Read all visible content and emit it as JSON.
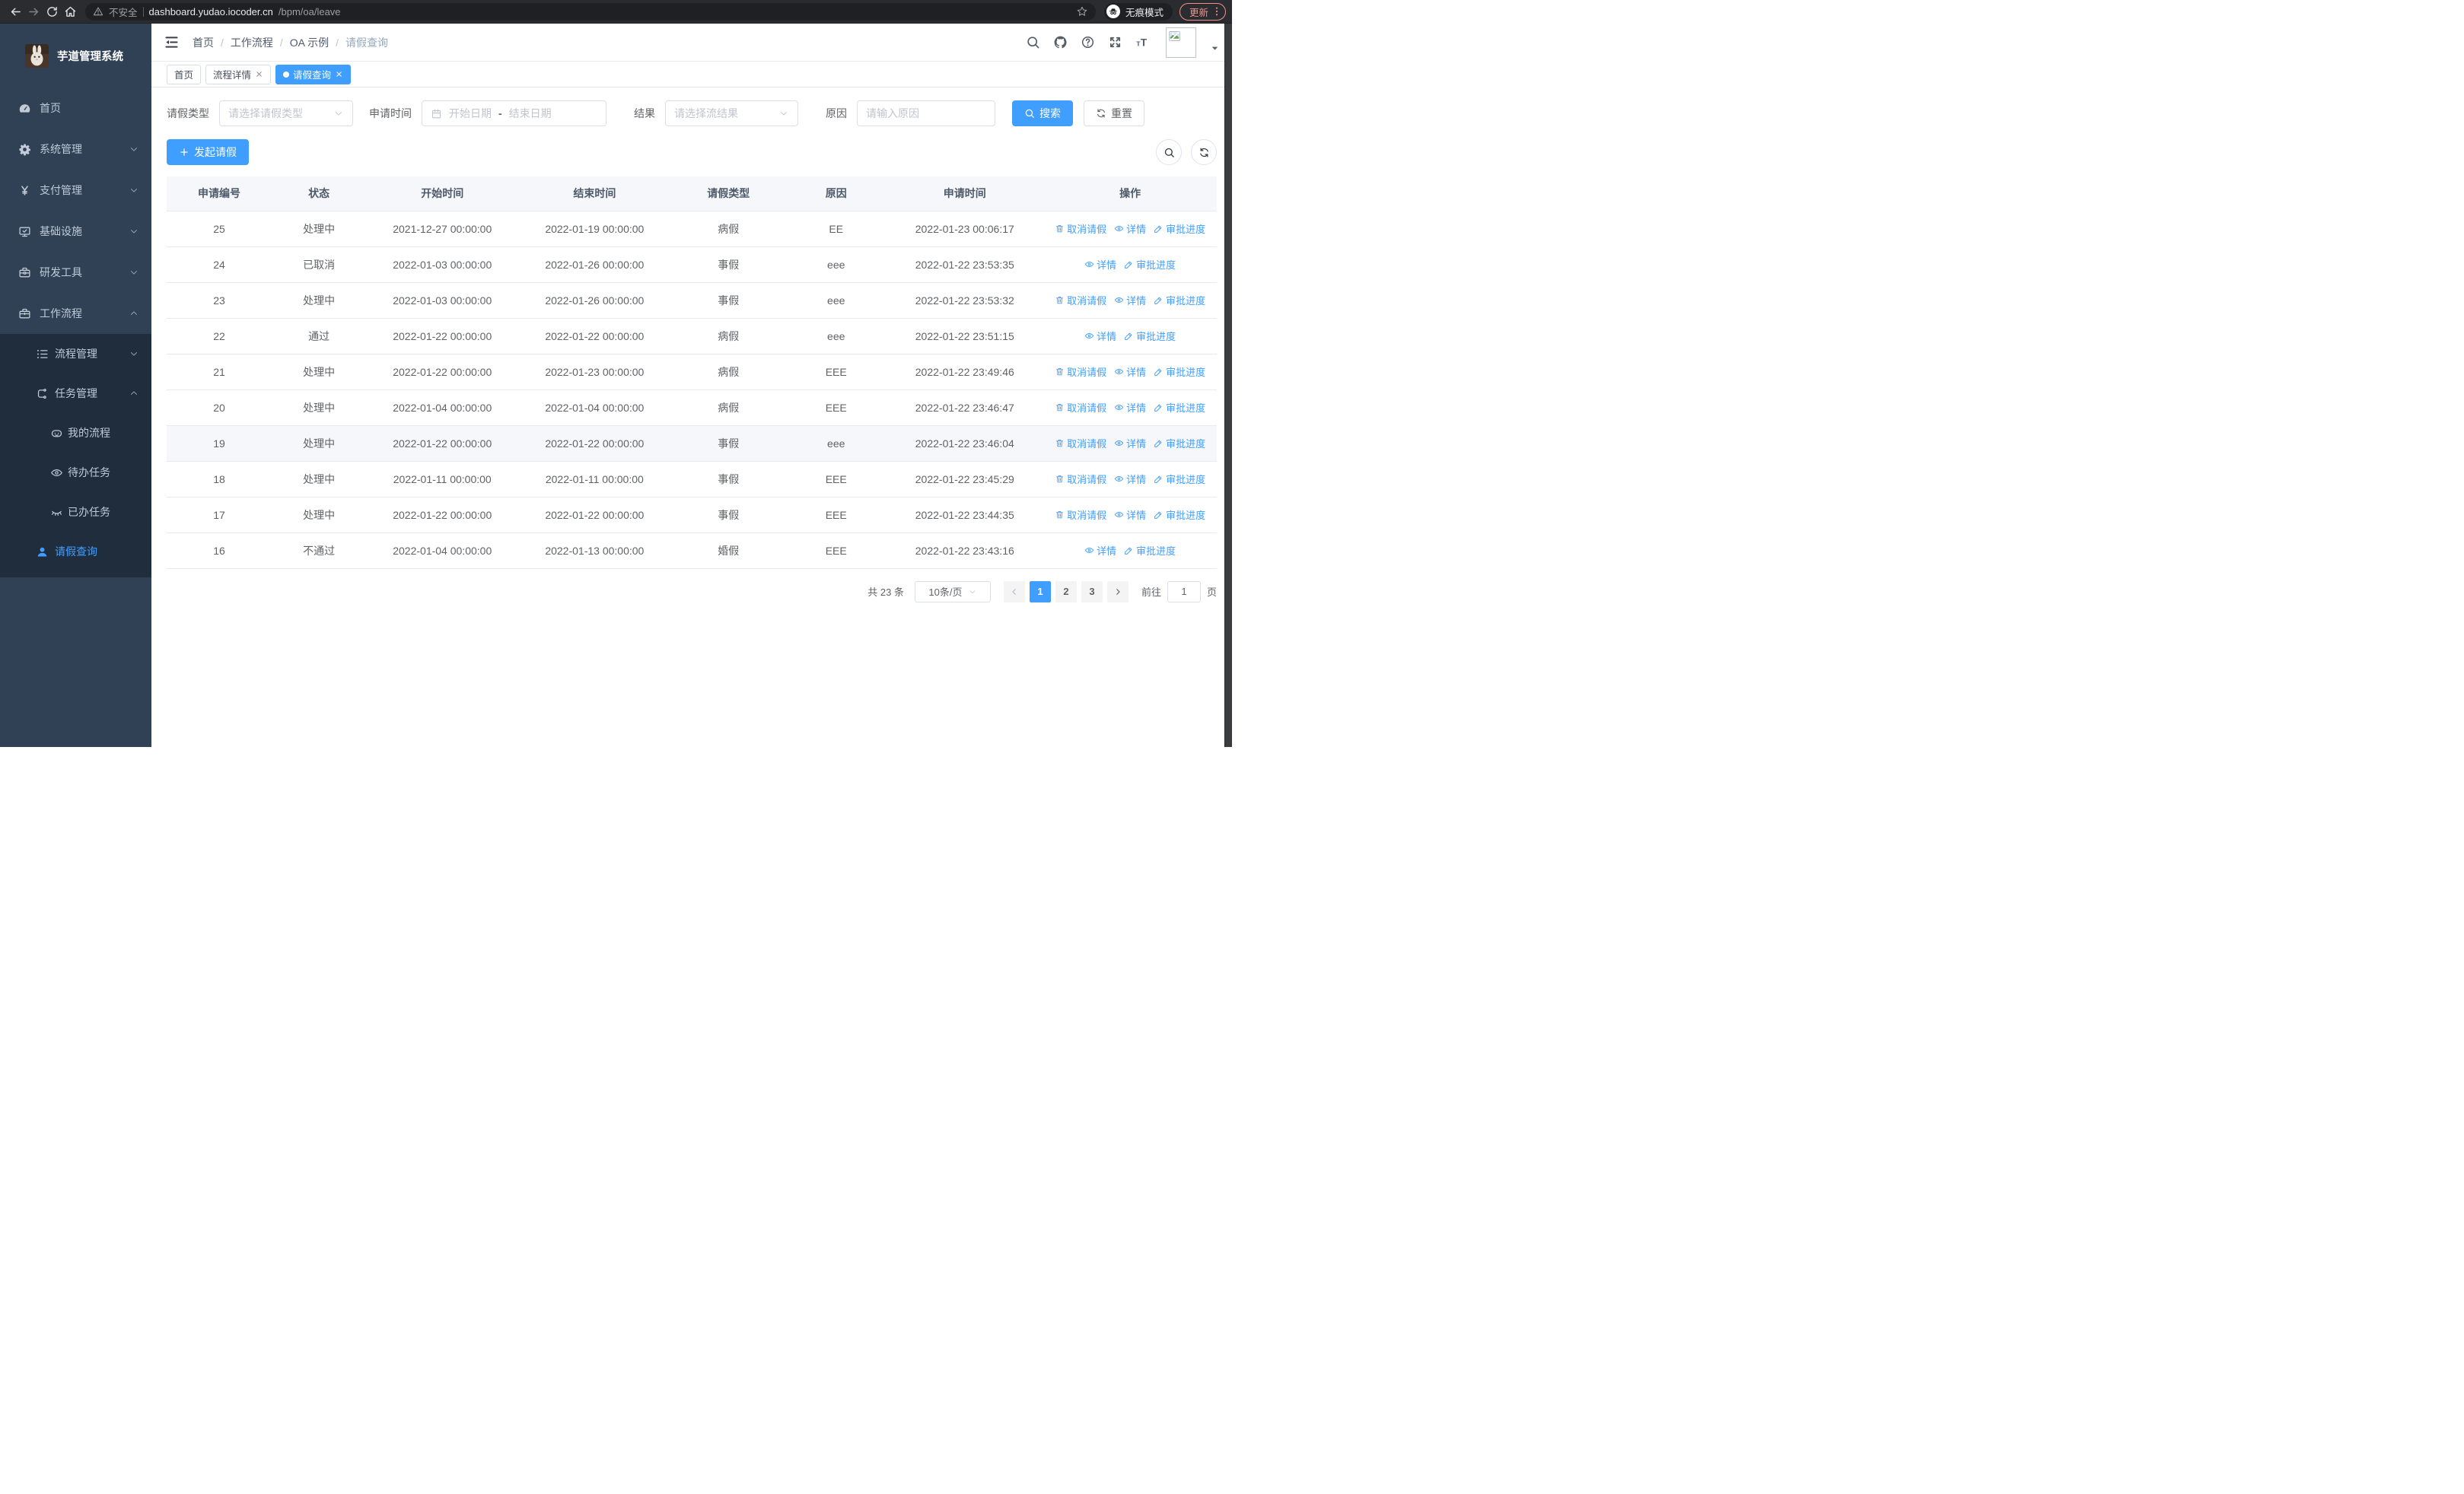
{
  "browser": {
    "security_label": "不安全",
    "url_host": "dashboard.yudao.iocoder.cn",
    "url_path": "/bpm/oa/leave",
    "incognito_label": "无痕模式",
    "update_label": "更新"
  },
  "sidebar": {
    "title": "芋道管理系统",
    "menu_top": [
      {
        "name": "home",
        "label": "首页",
        "icon": "dashboard-icon"
      },
      {
        "name": "system",
        "label": "系统管理",
        "icon": "gear-icon",
        "chevron": "down"
      },
      {
        "name": "payment",
        "label": "支付管理",
        "icon": "yen-icon",
        "chevron": "down"
      },
      {
        "name": "infrastructure",
        "label": "基础设施",
        "icon": "monitor-icon",
        "chevron": "down"
      },
      {
        "name": "dev-tools",
        "label": "研发工具",
        "icon": "toolbox-icon",
        "chevron": "down"
      },
      {
        "name": "workflow",
        "label": "工作流程",
        "icon": "briefcase-icon",
        "chevron": "up"
      }
    ],
    "menu_sub": [
      {
        "name": "process-mgmt",
        "label": "流程管理",
        "icon": "list-icon",
        "chevron": "down",
        "level": 2
      },
      {
        "name": "task-mgmt",
        "label": "任务管理",
        "icon": "flow-icon",
        "chevron": "up",
        "level": 2
      },
      {
        "name": "my-process",
        "label": "我的流程",
        "icon": "robot-icon",
        "level": 3
      },
      {
        "name": "todo-tasks",
        "label": "待办任务",
        "icon": "eye-icon",
        "level": 3
      },
      {
        "name": "done-tasks",
        "label": "已办任务",
        "icon": "eye-closed-icon",
        "level": 3
      },
      {
        "name": "leave-query",
        "label": "请假查询",
        "icon": "user-icon",
        "level": 2,
        "active": true
      }
    ]
  },
  "header": {
    "breadcrumb": [
      "首页",
      "工作流程",
      "OA 示例",
      "请假查询"
    ]
  },
  "tags": [
    {
      "label": "首页",
      "closable": false,
      "active": false
    },
    {
      "label": "流程详情",
      "closable": true,
      "active": false
    },
    {
      "label": "请假查询",
      "closable": true,
      "active": true
    }
  ],
  "filters": {
    "leave_type_label": "请假类型",
    "leave_type_placeholder": "请选择请假类型",
    "apply_time_label": "申请时间",
    "start_placeholder": "开始日期",
    "range_separator": "-",
    "end_placeholder": "结束日期",
    "result_label": "结果",
    "result_placeholder": "请选择流结果",
    "reason_label": "原因",
    "reason_placeholder": "请输入原因",
    "search_label": "搜索",
    "reset_label": "重置"
  },
  "toolbar": {
    "create_label": "发起请假"
  },
  "table": {
    "columns": [
      "申请编号",
      "状态",
      "开始时间",
      "结束时间",
      "请假类型",
      "原因",
      "申请时间",
      "操作"
    ],
    "action_labels": {
      "cancel": "取消请假",
      "detail": "详情",
      "progress": "审批进度"
    },
    "rows": [
      {
        "id": "25",
        "status": "处理中",
        "start": "2021-12-27 00:00:00",
        "end": "2022-01-19 00:00:00",
        "type": "病假",
        "reason": "EE",
        "apply_time": "2022-01-23 00:06:17",
        "actions": [
          "cancel",
          "detail",
          "progress"
        ],
        "highlight": false
      },
      {
        "id": "24",
        "status": "已取消",
        "start": "2022-01-03 00:00:00",
        "end": "2022-01-26 00:00:00",
        "type": "事假",
        "reason": "eee",
        "apply_time": "2022-01-22 23:53:35",
        "actions": [
          "detail",
          "progress"
        ],
        "highlight": false
      },
      {
        "id": "23",
        "status": "处理中",
        "start": "2022-01-03 00:00:00",
        "end": "2022-01-26 00:00:00",
        "type": "事假",
        "reason": "eee",
        "apply_time": "2022-01-22 23:53:32",
        "actions": [
          "cancel",
          "detail",
          "progress"
        ],
        "highlight": false
      },
      {
        "id": "22",
        "status": "通过",
        "start": "2022-01-22 00:00:00",
        "end": "2022-01-22 00:00:00",
        "type": "病假",
        "reason": "eee",
        "apply_time": "2022-01-22 23:51:15",
        "actions": [
          "detail",
          "progress"
        ],
        "highlight": false
      },
      {
        "id": "21",
        "status": "处理中",
        "start": "2022-01-22 00:00:00",
        "end": "2022-01-23 00:00:00",
        "type": "病假",
        "reason": "EEE",
        "apply_time": "2022-01-22 23:49:46",
        "actions": [
          "cancel",
          "detail",
          "progress"
        ],
        "highlight": false
      },
      {
        "id": "20",
        "status": "处理中",
        "start": "2022-01-04 00:00:00",
        "end": "2022-01-04 00:00:00",
        "type": "病假",
        "reason": "EEE",
        "apply_time": "2022-01-22 23:46:47",
        "actions": [
          "cancel",
          "detail",
          "progress"
        ],
        "highlight": false
      },
      {
        "id": "19",
        "status": "处理中",
        "start": "2022-01-22 00:00:00",
        "end": "2022-01-22 00:00:00",
        "type": "事假",
        "reason": "eee",
        "apply_time": "2022-01-22 23:46:04",
        "actions": [
          "cancel",
          "detail",
          "progress"
        ],
        "highlight": true
      },
      {
        "id": "18",
        "status": "处理中",
        "start": "2022-01-11 00:00:00",
        "end": "2022-01-11 00:00:00",
        "type": "事假",
        "reason": "EEE",
        "apply_time": "2022-01-22 23:45:29",
        "actions": [
          "cancel",
          "detail",
          "progress"
        ],
        "highlight": false
      },
      {
        "id": "17",
        "status": "处理中",
        "start": "2022-01-22 00:00:00",
        "end": "2022-01-22 00:00:00",
        "type": "事假",
        "reason": "EEE",
        "apply_time": "2022-01-22 23:44:35",
        "actions": [
          "cancel",
          "detail",
          "progress"
        ],
        "highlight": false
      },
      {
        "id": "16",
        "status": "不通过",
        "start": "2022-01-04 00:00:00",
        "end": "2022-01-13 00:00:00",
        "type": "婚假",
        "reason": "EEE",
        "apply_time": "2022-01-22 23:43:16",
        "actions": [
          "detail",
          "progress"
        ],
        "highlight": false
      }
    ]
  },
  "pagination": {
    "total_label": "共 23 条",
    "page_size_label": "10条/页",
    "pages": [
      "1",
      "2",
      "3"
    ],
    "current_page": "1",
    "goto_label": "前往",
    "goto_value": "1",
    "goto_unit": "页"
  },
  "colors": {
    "primary": "#409eff",
    "sidebar_bg": "#304156",
    "submenu_bg": "#1f2d3d",
    "update_accent": "#ec928c"
  }
}
